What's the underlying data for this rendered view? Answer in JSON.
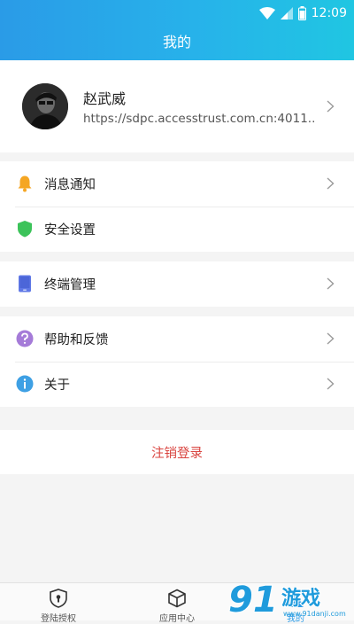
{
  "status_bar": {
    "time": "12:09"
  },
  "header": {
    "title": "我的"
  },
  "profile": {
    "name": "赵武威",
    "url": "https://sdpc.accesstrust.com.cn:4011..."
  },
  "groups": [
    [
      {
        "label": "消息通知",
        "icon": "bell-icon",
        "color": "#f5a623",
        "chevron": true
      },
      {
        "label": "安全设置",
        "icon": "shield-icon",
        "color": "#3cc35a",
        "chevron": false
      }
    ],
    [
      {
        "label": "终端管理",
        "icon": "phone-icon",
        "color": "#5f78e6",
        "chevron": true
      }
    ],
    [
      {
        "label": "帮助和反馈",
        "icon": "question-icon",
        "color": "#a57bd8",
        "chevron": true
      },
      {
        "label": "关于",
        "icon": "info-icon",
        "color": "#3ea0e4",
        "chevron": true
      }
    ]
  ],
  "logout": {
    "label": "注销登录",
    "color": "#d9443f"
  },
  "tabs": [
    {
      "label": "登陆授权",
      "icon": "keyhole-icon"
    },
    {
      "label": "应用中心",
      "icon": "box-icon"
    },
    {
      "label": "我的",
      "icon": "user-icon",
      "active": true
    }
  ],
  "watermark": {
    "text": "91游戏",
    "subtext": "www.91danji.com"
  }
}
